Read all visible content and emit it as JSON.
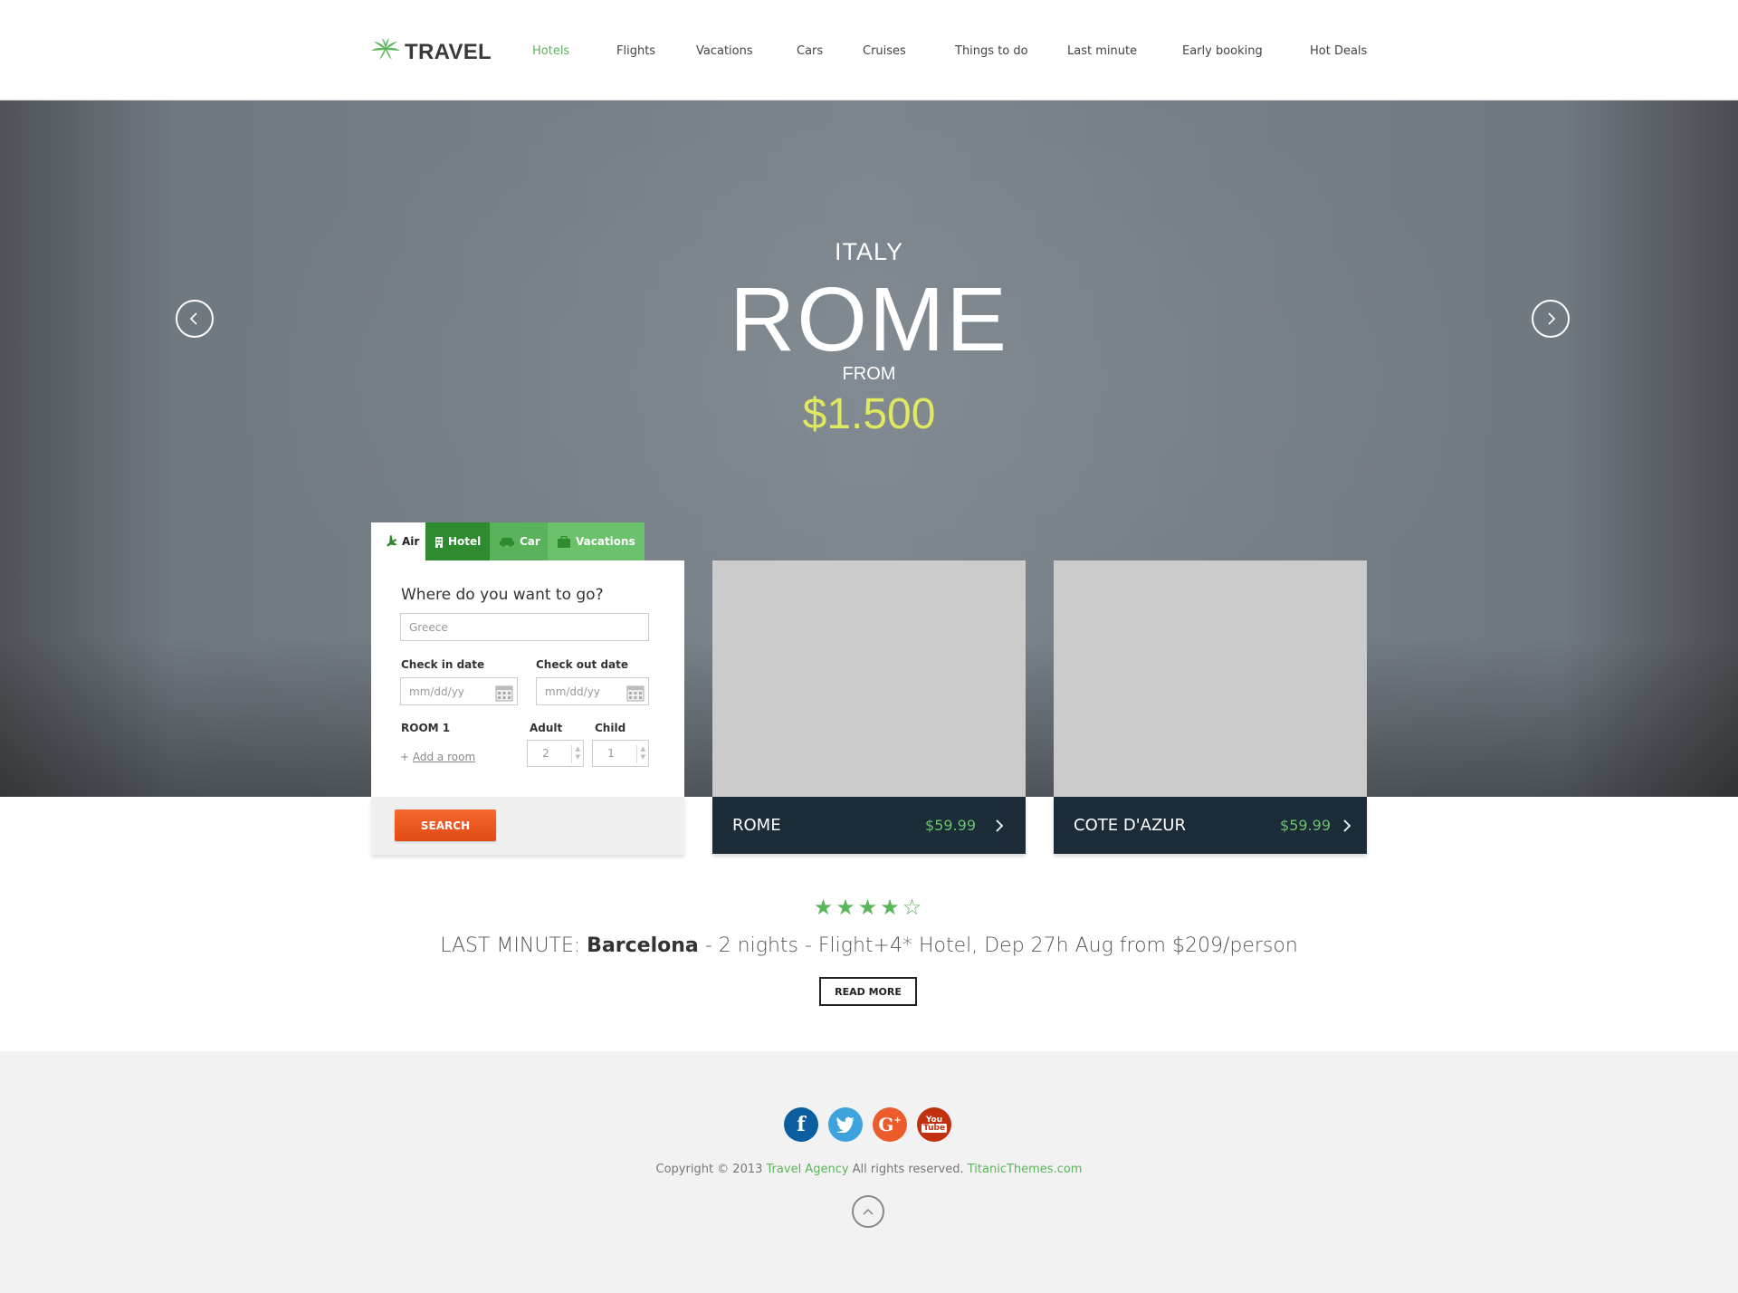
{
  "brand": {
    "name": "TRAVEL"
  },
  "nav": {
    "items": [
      {
        "label": "Hotels"
      },
      {
        "label": "Flights"
      },
      {
        "label": "Vacations"
      },
      {
        "label": "Cars"
      },
      {
        "label": "Cruises"
      },
      {
        "label": "Things to do"
      },
      {
        "label": "Last minute"
      },
      {
        "label": "Early booking"
      },
      {
        "label": "Hot Deals"
      }
    ],
    "active_index": 0
  },
  "hero": {
    "country": "ITALY",
    "city": "ROME",
    "from_label": "FROM",
    "price": "$1.500"
  },
  "search": {
    "tabs": [
      {
        "label": "Air",
        "icon": "plane-icon"
      },
      {
        "label": "Hotel",
        "icon": "building-icon"
      },
      {
        "label": "Car",
        "icon": "car-icon"
      },
      {
        "label": "Vacations",
        "icon": "suitcase-icon"
      }
    ],
    "active_tab": 0,
    "question": "Where do you want to go?",
    "destination_placeholder": "Greece",
    "checkin_label": "Check in date",
    "checkout_label": "Check out date",
    "date_placeholder": "mm/dd/yy",
    "room_label": "ROOM 1",
    "adult_label": "Adult",
    "child_label": "Child",
    "adult_value": "2",
    "child_value": "1",
    "add_room_prefix": "+ ",
    "add_room": "Add a room",
    "search_button": "SEARCH"
  },
  "cards": [
    {
      "name": "ROME",
      "price": "$59.99"
    },
    {
      "name": "COTE D'AZUR",
      "price": "$59.99"
    }
  ],
  "deal": {
    "stars_filled": 4,
    "stars_total": 5,
    "prefix": "LAST MINUTE: ",
    "city": "Barcelona",
    "details": " - 2 nights - Flight+4* Hotel, Dep 27h Aug from $209/person",
    "read_more": "READ MORE"
  },
  "footer": {
    "social": [
      {
        "name": "facebook",
        "color": "#0b5fa0"
      },
      {
        "name": "twitter",
        "color": "#3ea3dd"
      },
      {
        "name": "google-plus",
        "color": "#ec5b2c"
      },
      {
        "name": "youtube",
        "color": "#c2310f"
      }
    ],
    "copyright_prefix": "Copyright © 2013 ",
    "agency": "Travel Agency",
    "rights": " All rights reserved. ",
    "site": "TitanicThemes.com"
  },
  "colors": {
    "accent_green": "#5bb55a",
    "hero_price": "#dfe85e",
    "search_orange": "#ef5a22",
    "card_dark": "#1b2b38"
  }
}
